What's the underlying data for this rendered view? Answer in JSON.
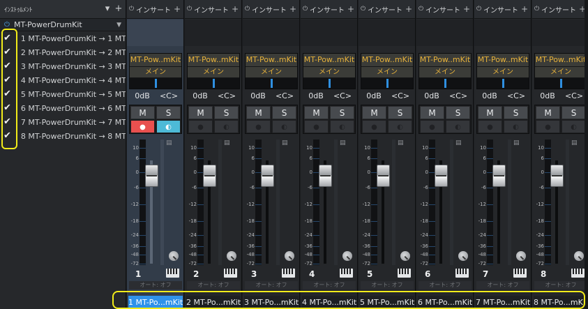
{
  "left_panel": {
    "title": "ｲﾝｽﾄｩﾙﾒﾝﾄ",
    "instrument_name": "MT-PowerDrumKit",
    "outputs": [
      {
        "label": "1 MT-PowerDrumKit → 1 MT",
        "checked": true
      },
      {
        "label": "2 MT-PowerDrumKit → 2 MT",
        "checked": true
      },
      {
        "label": "3 MT-PowerDrumKit → 3 MT",
        "checked": true
      },
      {
        "label": "4 MT-PowerDrumKit → 4 MT",
        "checked": true
      },
      {
        "label": "5 MT-PowerDrumKit → 5 MT",
        "checked": true
      },
      {
        "label": "6 MT-PowerDrumKit → 6 MT",
        "checked": true
      },
      {
        "label": "7 MT-PowerDrumKit → 7 MT",
        "checked": true
      },
      {
        "label": "8 MT-PowerDrumKit → 8 MT",
        "checked": true
      }
    ]
  },
  "mixer": {
    "insert_label": "インサート",
    "io_name": "MT-Pow..mKit",
    "bus_label": "メイン",
    "gain": "0dB",
    "pan": "<C>",
    "mute_label": "M",
    "solo_label": "S",
    "auto_label": "オート: オフ",
    "scale": [
      "10",
      "6",
      "0",
      "-6",
      "-12",
      "-18",
      "-24",
      "-36",
      "-48",
      "-72"
    ],
    "channels": [
      {
        "number": "1",
        "name": "1 MT-Po...mKit",
        "selected": true
      },
      {
        "number": "2",
        "name": "2 MT-Po...mKit",
        "selected": false
      },
      {
        "number": "3",
        "name": "3 MT-Po...mKit",
        "selected": false
      },
      {
        "number": "4",
        "name": "4 MT-Po...mKit",
        "selected": false
      },
      {
        "number": "5",
        "name": "5 MT-Po...mKit",
        "selected": false
      },
      {
        "number": "6",
        "name": "6 MT-Po...mKit",
        "selected": false
      },
      {
        "number": "7",
        "name": "7 MT-Po...mKit",
        "selected": false
      },
      {
        "number": "8",
        "name": "8 MT-Po...mKit",
        "selected": false
      }
    ]
  },
  "colors": {
    "highlight": "#f2ec1a",
    "selected_name_bg": "#2f92ea",
    "io_text": "#e7b23b",
    "record_active": "#e8504f",
    "monitor_active": "#4dbad7"
  }
}
